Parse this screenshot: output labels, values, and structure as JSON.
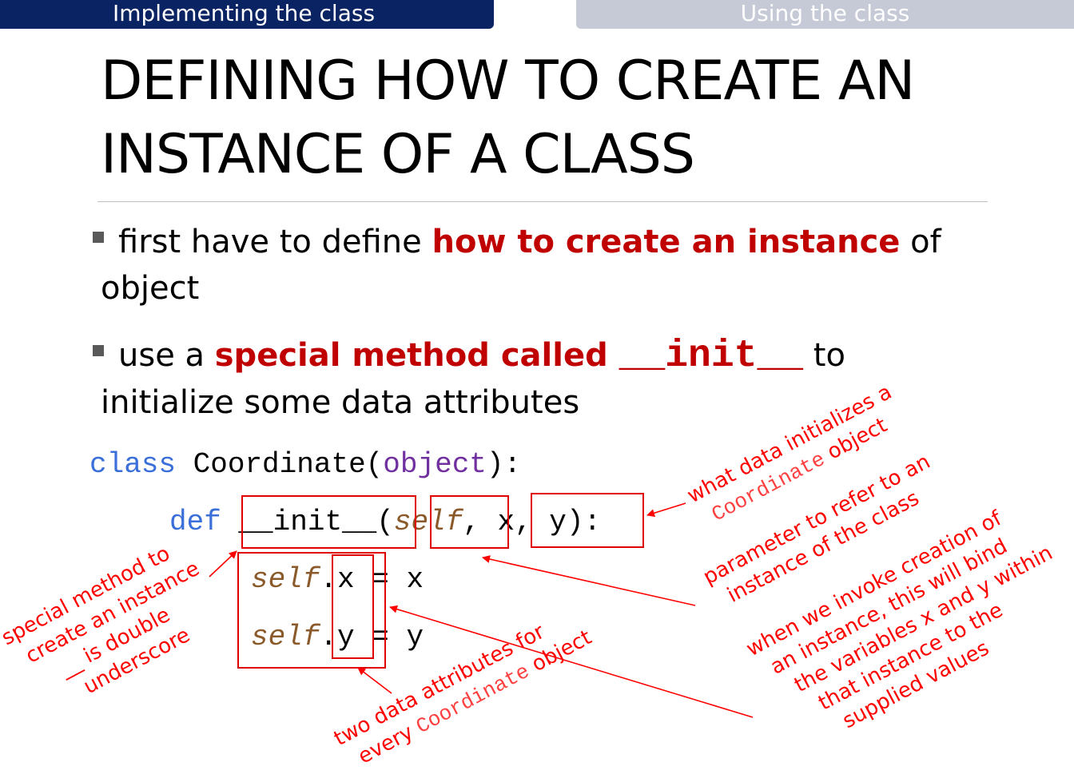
{
  "tabs": {
    "active": "Implementing the class",
    "inactive": "Using the class"
  },
  "title": {
    "line1": "DEFINING HOW TO CREATE AN",
    "line2": "INSTANCE OF A CLASS"
  },
  "bullets": [
    {
      "pre": "first have to define ",
      "highlight": "how to create an instance",
      "post": " of",
      "line2": "object"
    },
    {
      "pre": "use a ",
      "highlight": "special method called ",
      "code": "__init__",
      "post": "  to",
      "line2": "initialize some data attributes"
    }
  ],
  "code": {
    "l1_kw": "class",
    "l1_name": " Coordinate(",
    "l1_obj": "object",
    "l1_end": "):",
    "l2_kw": "def",
    "l2_init": "__init__",
    "l2_open": "(",
    "l2_self": "self",
    "l2_comma": ",",
    "l2_params": " x, y)",
    "l2_colon": ":",
    "l3_self": "self",
    "l3_attr": ".x",
    "l3_rest": " = x",
    "l4_self": "self",
    "l4_attr": ".y",
    "l4_rest": " = y"
  },
  "annotations": {
    "what_data": {
      "line1": "what data initializes a",
      "code": "Coordinate",
      "line2_rest": " object"
    },
    "parameter": {
      "line1": "parameter to refer to an",
      "line2": "instance of the class"
    },
    "when_invoke": {
      "line1": "when we invoke creation of",
      "line2": "an instance, this will bind",
      "line3": "the variables x and y within",
      "line4": "that instance to the",
      "line5": "supplied values"
    },
    "special_method": {
      "line1": "special method to",
      "line2": "create an instance",
      "line3": "__ is double",
      "line4": "underscore"
    },
    "two_attrs": {
      "line1": "two data attributes for",
      "line2_pre": "every ",
      "code": "Coordinate",
      "line2_post": " object"
    }
  }
}
